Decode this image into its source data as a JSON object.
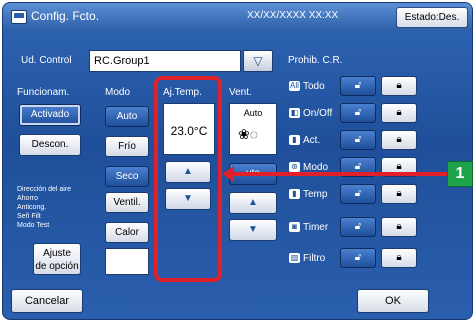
{
  "window": {
    "title": "Config. Fcto.",
    "datetime": "XX/XX/XXXX  XX:XX",
    "status_button": "Estado:Des."
  },
  "ud_control": {
    "label": "Ud. Control",
    "value": "RC.Group1",
    "dropdown_glyph": "▽"
  },
  "funcionam": {
    "label": "Funcionam.",
    "activado": "Activado",
    "descon": "Descon."
  },
  "modo": {
    "label": "Modo",
    "options": [
      "Auto",
      "Frío",
      "Seco",
      "Ventil.",
      "Calor"
    ]
  },
  "aj_temp": {
    "label": "Aj.Temp.",
    "value": "23.0°C"
  },
  "vent": {
    "label": "Vent.",
    "current": "Auto",
    "auto_button": "uto"
  },
  "direction_text": [
    "Dirección del aire",
    "Ahorro",
    "Anticong.",
    "Señ Filt",
    "Modo Test"
  ],
  "ajuste_button": [
    "Ajuste",
    "de opción"
  ],
  "prohib": {
    "label": "Prohib. C.R.",
    "rows": [
      {
        "icon": "All",
        "label": "Todo"
      },
      {
        "icon": "◧",
        "label": "On/Off"
      },
      {
        "icon": "▮",
        "label": "Act."
      },
      {
        "icon": "⊛",
        "label": "Modo"
      },
      {
        "icon": "▮",
        "label": "Temp"
      },
      {
        "icon": "◙",
        "label": "Timer"
      },
      {
        "icon": "▨",
        "label": "Filtro"
      }
    ]
  },
  "footer": {
    "cancel": "Cancelar",
    "ok": "OK"
  },
  "callout": {
    "badge": "1"
  },
  "glyphs": {
    "arrow_up": "▲",
    "arrow_down": "▼",
    "lock_open": "🔓︎",
    "lock_closed": "🔒︎",
    "fan": "❀◌"
  },
  "colors": {
    "panel_blue": "#1f4f9a",
    "highlight_red": "#e2202a",
    "badge_green": "#1fa34a"
  }
}
